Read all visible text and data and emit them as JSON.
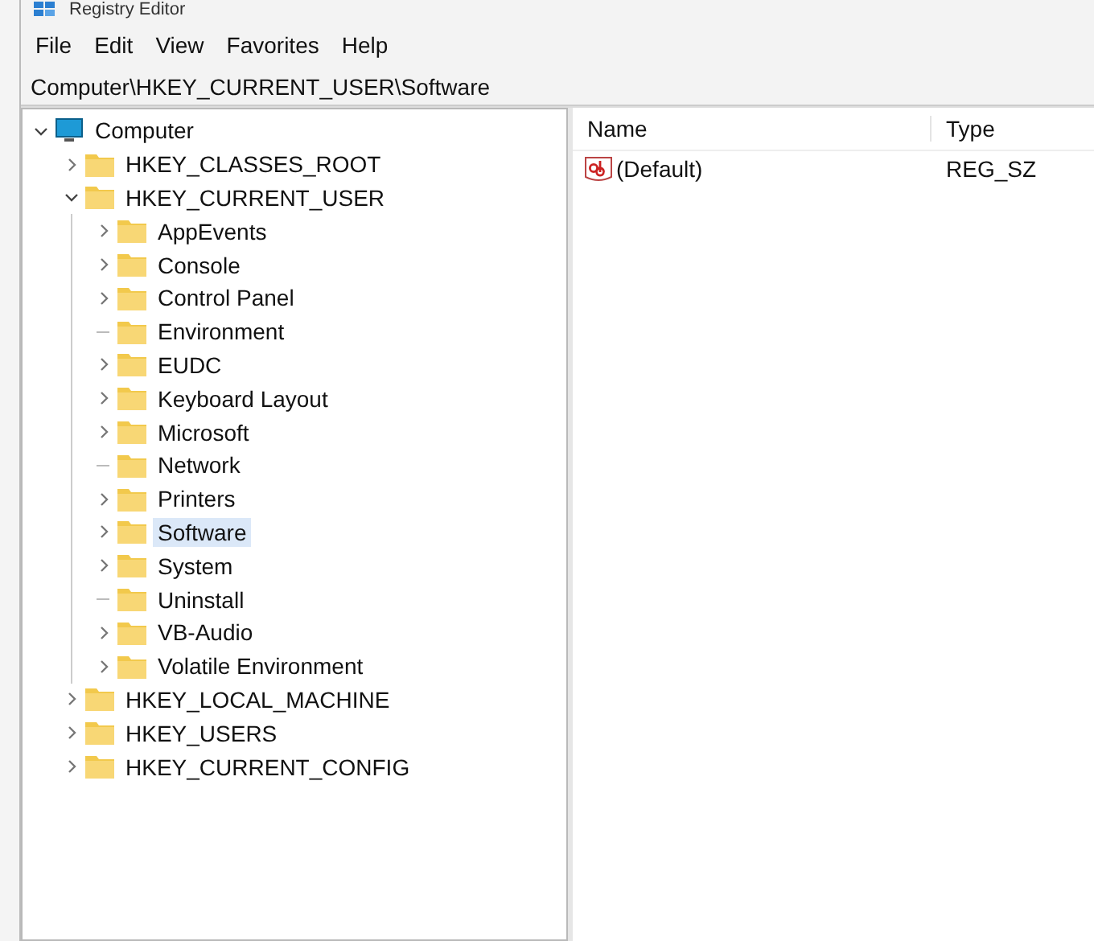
{
  "window": {
    "title": "Registry Editor"
  },
  "menu": [
    {
      "label": "File"
    },
    {
      "label": "Edit"
    },
    {
      "label": "View"
    },
    {
      "label": "Favorites"
    },
    {
      "label": "Help"
    }
  ],
  "address_bar": {
    "value": "Computer\\HKEY_CURRENT_USER\\Software"
  },
  "tree": [
    {
      "label": "Computer",
      "kind": "computer",
      "expanded": true,
      "selected": false,
      "children": [
        {
          "label": "HKEY_CLASSES_ROOT",
          "kind": "folder",
          "expanded": false,
          "selected": false,
          "has_children": true
        },
        {
          "label": "HKEY_CURRENT_USER",
          "kind": "folder",
          "expanded": true,
          "selected": false,
          "has_children": true,
          "children": [
            {
              "label": "AppEvents",
              "kind": "folder",
              "expanded": false,
              "selected": false,
              "has_children": true
            },
            {
              "label": "Console",
              "kind": "folder",
              "expanded": false,
              "selected": false,
              "has_children": true
            },
            {
              "label": "Control Panel",
              "kind": "folder",
              "expanded": false,
              "selected": false,
              "has_children": true
            },
            {
              "label": "Environment",
              "kind": "folder",
              "expanded": false,
              "selected": false,
              "has_children": false
            },
            {
              "label": "EUDC",
              "kind": "folder",
              "expanded": false,
              "selected": false,
              "has_children": true
            },
            {
              "label": "Keyboard Layout",
              "kind": "folder",
              "expanded": false,
              "selected": false,
              "has_children": true
            },
            {
              "label": "Microsoft",
              "kind": "folder",
              "expanded": false,
              "selected": false,
              "has_children": true
            },
            {
              "label": "Network",
              "kind": "folder",
              "expanded": false,
              "selected": false,
              "has_children": false
            },
            {
              "label": "Printers",
              "kind": "folder",
              "expanded": false,
              "selected": false,
              "has_children": true
            },
            {
              "label": "Software",
              "kind": "folder",
              "expanded": false,
              "selected": true,
              "has_children": true
            },
            {
              "label": "System",
              "kind": "folder",
              "expanded": false,
              "selected": false,
              "has_children": true
            },
            {
              "label": "Uninstall",
              "kind": "folder",
              "expanded": false,
              "selected": false,
              "has_children": false
            },
            {
              "label": "VB-Audio",
              "kind": "folder",
              "expanded": false,
              "selected": false,
              "has_children": true
            },
            {
              "label": "Volatile Environment",
              "kind": "folder",
              "expanded": false,
              "selected": false,
              "has_children": true
            }
          ]
        },
        {
          "label": "HKEY_LOCAL_MACHINE",
          "kind": "folder",
          "expanded": false,
          "selected": false,
          "has_children": true
        },
        {
          "label": "HKEY_USERS",
          "kind": "folder",
          "expanded": false,
          "selected": false,
          "has_children": true
        },
        {
          "label": "HKEY_CURRENT_CONFIG",
          "kind": "folder",
          "expanded": false,
          "selected": false,
          "has_children": true
        }
      ]
    }
  ],
  "values": {
    "columns": [
      "Name",
      "Type"
    ],
    "rows": [
      {
        "name": "(Default)",
        "type": "REG_SZ",
        "kind": "string"
      }
    ]
  }
}
